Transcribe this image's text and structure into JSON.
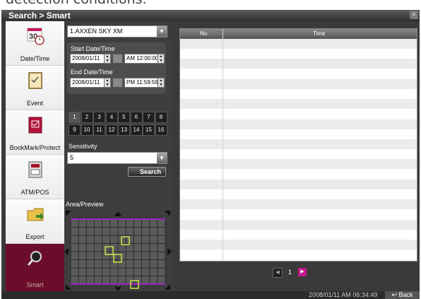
{
  "top_caption": "detection conditions.",
  "window": {
    "title": "Search > Smart",
    "close_icon": "close-icon"
  },
  "sidebar": {
    "items": [
      {
        "label": "Date/Time",
        "icon": "calendar-clock-icon",
        "calendar_number": "30"
      },
      {
        "label": "Event",
        "icon": "clipboard-icon"
      },
      {
        "label": "BookMark/Protect",
        "icon": "bookmark-icon"
      },
      {
        "label": "ATM/POS",
        "icon": "atm-icon"
      },
      {
        "label": "Export",
        "icon": "folder-export-icon"
      },
      {
        "label": "Smart",
        "icon": "magnifier-icon",
        "active": true
      }
    ]
  },
  "filters": {
    "camera_select": "1.AXXEN SKY XM",
    "start": {
      "label": "Start Date/Time",
      "date": "2008/01/11",
      "time": "AM 12:00:00"
    },
    "end": {
      "label": "End Date/Time",
      "date": "2008/01/11",
      "time": "PM 11:59:59"
    },
    "channels": [
      "1",
      "2",
      "3",
      "4",
      "5",
      "6",
      "7",
      "8",
      "9",
      "10",
      "11",
      "12",
      "13",
      "14",
      "15",
      "16"
    ],
    "selected_channel": "1",
    "sensitivity_label": "Sensitivity",
    "sensitivity_value": "5",
    "search_label": "Search",
    "area_label": "Area/Preview"
  },
  "table": {
    "columns": [
      "No.",
      "Time"
    ],
    "rows": []
  },
  "pager": {
    "page": "1"
  },
  "status": {
    "datetime": "2008/01/11 AM 06:34:49",
    "back_label": "Back"
  },
  "colors": {
    "active_sidebar": "#6b0d2a",
    "grid_green": "#c8e64a",
    "pager_next": "#c0188c"
  }
}
